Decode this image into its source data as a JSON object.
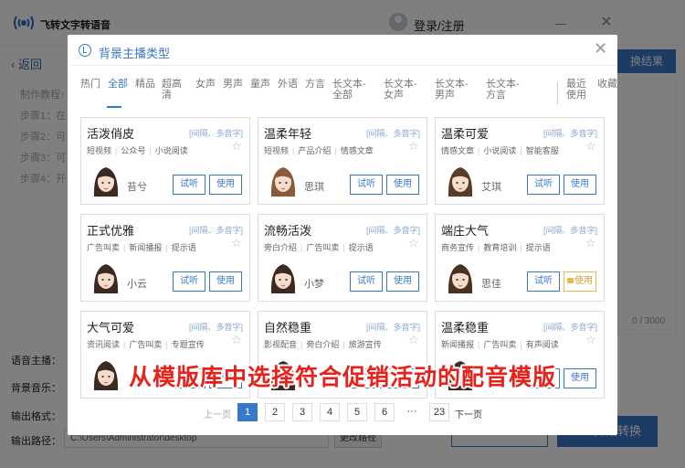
{
  "app": {
    "title": "飞转文字转语音",
    "login": "登录/注册",
    "back": "返回",
    "results_button": "换结果",
    "tutorial": {
      "heading": "制作教程↑",
      "steps": [
        "步骤1：在",
        "步骤2：可",
        "步骤3：可",
        "步骤4：开"
      ]
    },
    "char_count": "0 / 3000",
    "form": {
      "voice_label": "语音主播：",
      "bgm_label": "背景音乐：",
      "format_label": "输出格式：",
      "path_label": "输出路径：",
      "path_value": "C:\\Users\\Administrator\\desktop",
      "change_path": "更改路径"
    },
    "convert_button": "开始转换"
  },
  "modal": {
    "title": "背景主播类型",
    "tabs": [
      {
        "label": "热门",
        "active": false
      },
      {
        "label": "全部",
        "active": true
      },
      {
        "label": "精品",
        "active": false
      },
      {
        "label": "超高清",
        "active": false
      },
      {
        "label": "女声",
        "active": false
      },
      {
        "label": "男声",
        "active": false
      },
      {
        "label": "童声",
        "active": false
      },
      {
        "label": "外语",
        "active": false
      },
      {
        "label": "方言",
        "active": false
      },
      {
        "label": "长文本-全部",
        "active": false
      },
      {
        "label": "长文本-女声",
        "active": false
      },
      {
        "label": "长文本-男声",
        "active": false
      },
      {
        "label": "长文本-方言",
        "active": false
      },
      {
        "label": "最近使用",
        "active": false
      },
      {
        "label": "收藏",
        "active": false
      }
    ],
    "try_label": "试听",
    "use_label": "使用",
    "cards": [
      {
        "name": "活泼俏皮",
        "hint": "[间隔、多音字]",
        "tags": [
          "短视频",
          "公众号",
          "小说阅读"
        ],
        "voice": "苔兮",
        "vip": false,
        "hair": "#3b2a22"
      },
      {
        "name": "温柔年轻",
        "hint": "[间隔、多音字]",
        "tags": [
          "短视频",
          "产品介绍",
          "情感文章"
        ],
        "voice": "思琪",
        "vip": false,
        "hair": "#8a5a3a"
      },
      {
        "name": "温柔可爱",
        "hint": "[间隔、多音字]",
        "tags": [
          "情感文章",
          "小说阅读",
          "智能客服"
        ],
        "voice": "艾琪",
        "vip": false,
        "hair": "#5a3a28"
      },
      {
        "name": "正式优雅",
        "hint": "[间隔、多音字]",
        "tags": [
          "广告叫卖",
          "新闻播报",
          "提示语"
        ],
        "voice": "小云",
        "vip": false,
        "hair": "#3b2a22"
      },
      {
        "name": "流畅活泼",
        "hint": "[间隔、多音字]",
        "tags": [
          "旁白介绍",
          "广告叫卖",
          "提示语"
        ],
        "voice": "小梦",
        "vip": false,
        "hair": "#3b2a22"
      },
      {
        "name": "端庄大气",
        "hint": "[间隔、多音字]",
        "tags": [
          "商务宣传",
          "教育培训",
          "提示语"
        ],
        "voice": "思佳",
        "vip": true,
        "hair": "#4a3020"
      },
      {
        "name": "大气可爱",
        "hint": "[间隔、多音字]",
        "tags": [
          "资讯阅读",
          "广告叫卖",
          "专题宣传"
        ],
        "voice": "",
        "vip": false,
        "hair": "#3b2a22"
      },
      {
        "name": "自然稳重",
        "hint": "[间隔、多音字]",
        "tags": [
          "影视配音",
          "旁白介绍",
          "旅游宣传"
        ],
        "voice": "",
        "vip": false,
        "hair": "#3b2a22"
      },
      {
        "name": "温柔稳重",
        "hint": "[间隔、多音字]",
        "tags": [
          "新闻播报",
          "广告叫卖",
          "有声阅读"
        ],
        "voice": "",
        "vip": false,
        "hair": "#3b2a22"
      }
    ],
    "pagination": {
      "prev": "上一页",
      "pages": [
        "1",
        "2",
        "3",
        "4",
        "5",
        "6",
        "···",
        "23"
      ],
      "current": "1",
      "next": "下一页"
    }
  },
  "caption": "从模版库中选择符合促销活动的配音模版",
  "colors": {
    "accent": "#3878c8",
    "caption": "#e8221b",
    "vip": "#e7b84a"
  }
}
